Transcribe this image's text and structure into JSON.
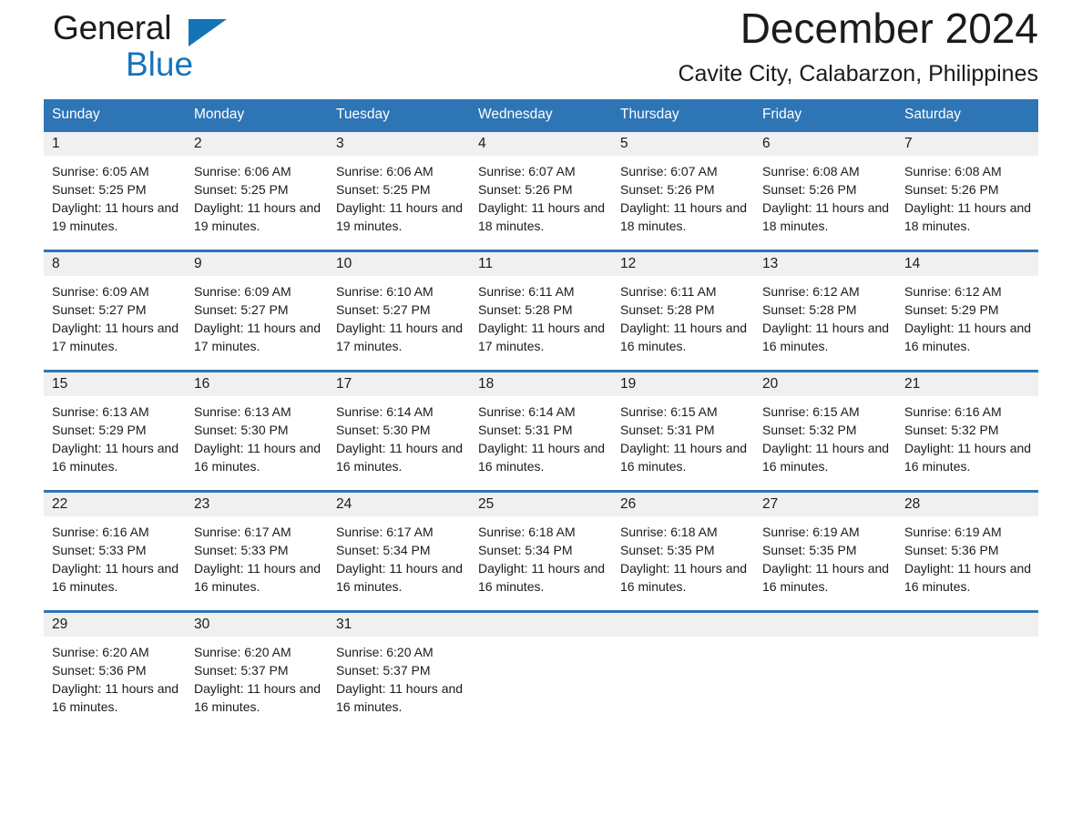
{
  "brand": {
    "name_part1": "General",
    "name_part2": "Blue",
    "logo_icon": "triangle-flag-icon",
    "accent_color": "#1574b8"
  },
  "header": {
    "month_title": "December 2024",
    "location": "Cavite City, Calabarzon, Philippines"
  },
  "calendar": {
    "header_color": "#2e75b6",
    "daynum_band_color": "#f0f0f0",
    "weekday_headers": [
      "Sunday",
      "Monday",
      "Tuesday",
      "Wednesday",
      "Thursday",
      "Friday",
      "Saturday"
    ],
    "weeks": [
      [
        {
          "day": "1",
          "sunrise": "Sunrise: 6:05 AM",
          "sunset": "Sunset: 5:25 PM",
          "daylight": "Daylight: 11 hours and 19 minutes."
        },
        {
          "day": "2",
          "sunrise": "Sunrise: 6:06 AM",
          "sunset": "Sunset: 5:25 PM",
          "daylight": "Daylight: 11 hours and 19 minutes."
        },
        {
          "day": "3",
          "sunrise": "Sunrise: 6:06 AM",
          "sunset": "Sunset: 5:25 PM",
          "daylight": "Daylight: 11 hours and 19 minutes."
        },
        {
          "day": "4",
          "sunrise": "Sunrise: 6:07 AM",
          "sunset": "Sunset: 5:26 PM",
          "daylight": "Daylight: 11 hours and 18 minutes."
        },
        {
          "day": "5",
          "sunrise": "Sunrise: 6:07 AM",
          "sunset": "Sunset: 5:26 PM",
          "daylight": "Daylight: 11 hours and 18 minutes."
        },
        {
          "day": "6",
          "sunrise": "Sunrise: 6:08 AM",
          "sunset": "Sunset: 5:26 PM",
          "daylight": "Daylight: 11 hours and 18 minutes."
        },
        {
          "day": "7",
          "sunrise": "Sunrise: 6:08 AM",
          "sunset": "Sunset: 5:26 PM",
          "daylight": "Daylight: 11 hours and 18 minutes."
        }
      ],
      [
        {
          "day": "8",
          "sunrise": "Sunrise: 6:09 AM",
          "sunset": "Sunset: 5:27 PM",
          "daylight": "Daylight: 11 hours and 17 minutes."
        },
        {
          "day": "9",
          "sunrise": "Sunrise: 6:09 AM",
          "sunset": "Sunset: 5:27 PM",
          "daylight": "Daylight: 11 hours and 17 minutes."
        },
        {
          "day": "10",
          "sunrise": "Sunrise: 6:10 AM",
          "sunset": "Sunset: 5:27 PM",
          "daylight": "Daylight: 11 hours and 17 minutes."
        },
        {
          "day": "11",
          "sunrise": "Sunrise: 6:11 AM",
          "sunset": "Sunset: 5:28 PM",
          "daylight": "Daylight: 11 hours and 17 minutes."
        },
        {
          "day": "12",
          "sunrise": "Sunrise: 6:11 AM",
          "sunset": "Sunset: 5:28 PM",
          "daylight": "Daylight: 11 hours and 16 minutes."
        },
        {
          "day": "13",
          "sunrise": "Sunrise: 6:12 AM",
          "sunset": "Sunset: 5:28 PM",
          "daylight": "Daylight: 11 hours and 16 minutes."
        },
        {
          "day": "14",
          "sunrise": "Sunrise: 6:12 AM",
          "sunset": "Sunset: 5:29 PM",
          "daylight": "Daylight: 11 hours and 16 minutes."
        }
      ],
      [
        {
          "day": "15",
          "sunrise": "Sunrise: 6:13 AM",
          "sunset": "Sunset: 5:29 PM",
          "daylight": "Daylight: 11 hours and 16 minutes."
        },
        {
          "day": "16",
          "sunrise": "Sunrise: 6:13 AM",
          "sunset": "Sunset: 5:30 PM",
          "daylight": "Daylight: 11 hours and 16 minutes."
        },
        {
          "day": "17",
          "sunrise": "Sunrise: 6:14 AM",
          "sunset": "Sunset: 5:30 PM",
          "daylight": "Daylight: 11 hours and 16 minutes."
        },
        {
          "day": "18",
          "sunrise": "Sunrise: 6:14 AM",
          "sunset": "Sunset: 5:31 PM",
          "daylight": "Daylight: 11 hours and 16 minutes."
        },
        {
          "day": "19",
          "sunrise": "Sunrise: 6:15 AM",
          "sunset": "Sunset: 5:31 PM",
          "daylight": "Daylight: 11 hours and 16 minutes."
        },
        {
          "day": "20",
          "sunrise": "Sunrise: 6:15 AM",
          "sunset": "Sunset: 5:32 PM",
          "daylight": "Daylight: 11 hours and 16 minutes."
        },
        {
          "day": "21",
          "sunrise": "Sunrise: 6:16 AM",
          "sunset": "Sunset: 5:32 PM",
          "daylight": "Daylight: 11 hours and 16 minutes."
        }
      ],
      [
        {
          "day": "22",
          "sunrise": "Sunrise: 6:16 AM",
          "sunset": "Sunset: 5:33 PM",
          "daylight": "Daylight: 11 hours and 16 minutes."
        },
        {
          "day": "23",
          "sunrise": "Sunrise: 6:17 AM",
          "sunset": "Sunset: 5:33 PM",
          "daylight": "Daylight: 11 hours and 16 minutes."
        },
        {
          "day": "24",
          "sunrise": "Sunrise: 6:17 AM",
          "sunset": "Sunset: 5:34 PM",
          "daylight": "Daylight: 11 hours and 16 minutes."
        },
        {
          "day": "25",
          "sunrise": "Sunrise: 6:18 AM",
          "sunset": "Sunset: 5:34 PM",
          "daylight": "Daylight: 11 hours and 16 minutes."
        },
        {
          "day": "26",
          "sunrise": "Sunrise: 6:18 AM",
          "sunset": "Sunset: 5:35 PM",
          "daylight": "Daylight: 11 hours and 16 minutes."
        },
        {
          "day": "27",
          "sunrise": "Sunrise: 6:19 AM",
          "sunset": "Sunset: 5:35 PM",
          "daylight": "Daylight: 11 hours and 16 minutes."
        },
        {
          "day": "28",
          "sunrise": "Sunrise: 6:19 AM",
          "sunset": "Sunset: 5:36 PM",
          "daylight": "Daylight: 11 hours and 16 minutes."
        }
      ],
      [
        {
          "day": "29",
          "sunrise": "Sunrise: 6:20 AM",
          "sunset": "Sunset: 5:36 PM",
          "daylight": "Daylight: 11 hours and 16 minutes."
        },
        {
          "day": "30",
          "sunrise": "Sunrise: 6:20 AM",
          "sunset": "Sunset: 5:37 PM",
          "daylight": "Daylight: 11 hours and 16 minutes."
        },
        {
          "day": "31",
          "sunrise": "Sunrise: 6:20 AM",
          "sunset": "Sunset: 5:37 PM",
          "daylight": "Daylight: 11 hours and 16 minutes."
        },
        {
          "day": "",
          "sunrise": "",
          "sunset": "",
          "daylight": ""
        },
        {
          "day": "",
          "sunrise": "",
          "sunset": "",
          "daylight": ""
        },
        {
          "day": "",
          "sunrise": "",
          "sunset": "",
          "daylight": ""
        },
        {
          "day": "",
          "sunrise": "",
          "sunset": "",
          "daylight": ""
        }
      ]
    ]
  }
}
